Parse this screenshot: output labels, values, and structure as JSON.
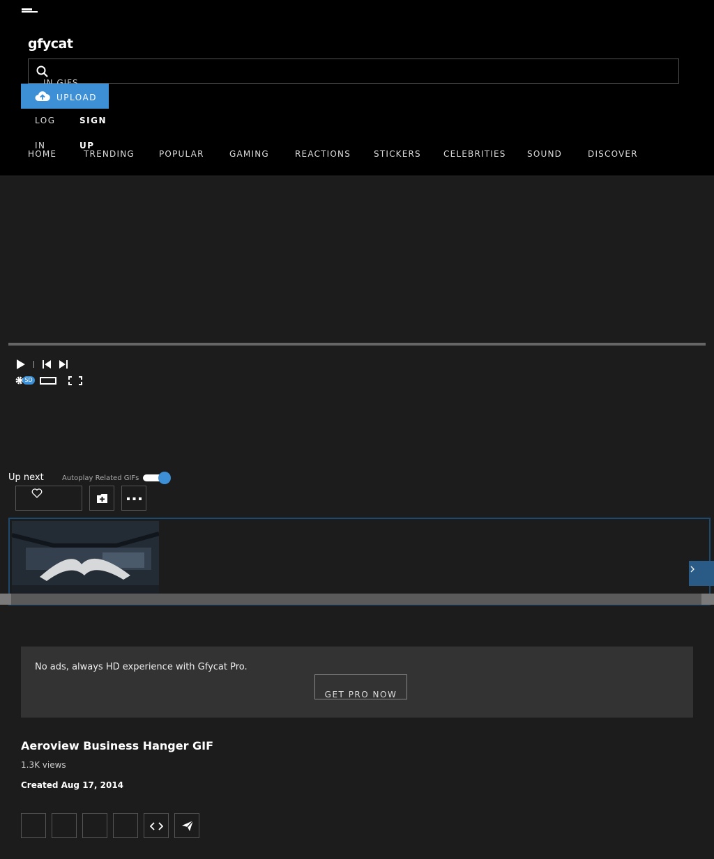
{
  "header": {
    "logo": "gfycat",
    "search": {
      "value": "",
      "placeholder": "",
      "hint": "IN GIFS"
    },
    "upload_label": "UPLOAD",
    "login_label": "LOG IN",
    "signup_label": "SIGN UP",
    "nav": [
      "HOME",
      "TRENDING",
      "POPULAR",
      "GAMING",
      "REACTIONS",
      "STICKERS",
      "CELEBRITIES",
      "SOUND",
      "DISCOVER"
    ]
  },
  "player": {
    "quality_badge": "SD",
    "progress_fraction": 0.0
  },
  "upnext": {
    "label": "Up next",
    "autoplay_label": "Autoplay Related GIFs",
    "autoplay_on": true
  },
  "pro_banner": {
    "text": "No ads, always HD experience with Gfycat Pro.",
    "button_label": "GET PRO NOW"
  },
  "gif": {
    "title": "Aeroview Business Hanger GIF",
    "views": "1.3K views",
    "created": "Created Aug 17, 2014"
  },
  "colors": {
    "accent": "#3d8fd6",
    "header_bg": "#000000",
    "page_bg": "#1c1c1c",
    "banner_bg": "#333333"
  },
  "icons": [
    "menu-icon",
    "search-icon",
    "upload-cloud-icon",
    "play-icon",
    "previous-icon",
    "next-icon",
    "settings-icon",
    "theater-mode-icon",
    "fullscreen-icon",
    "heart-icon",
    "add-to-collection-icon",
    "more-icon",
    "chevron-right-icon",
    "embed-code-icon",
    "send-icon"
  ]
}
